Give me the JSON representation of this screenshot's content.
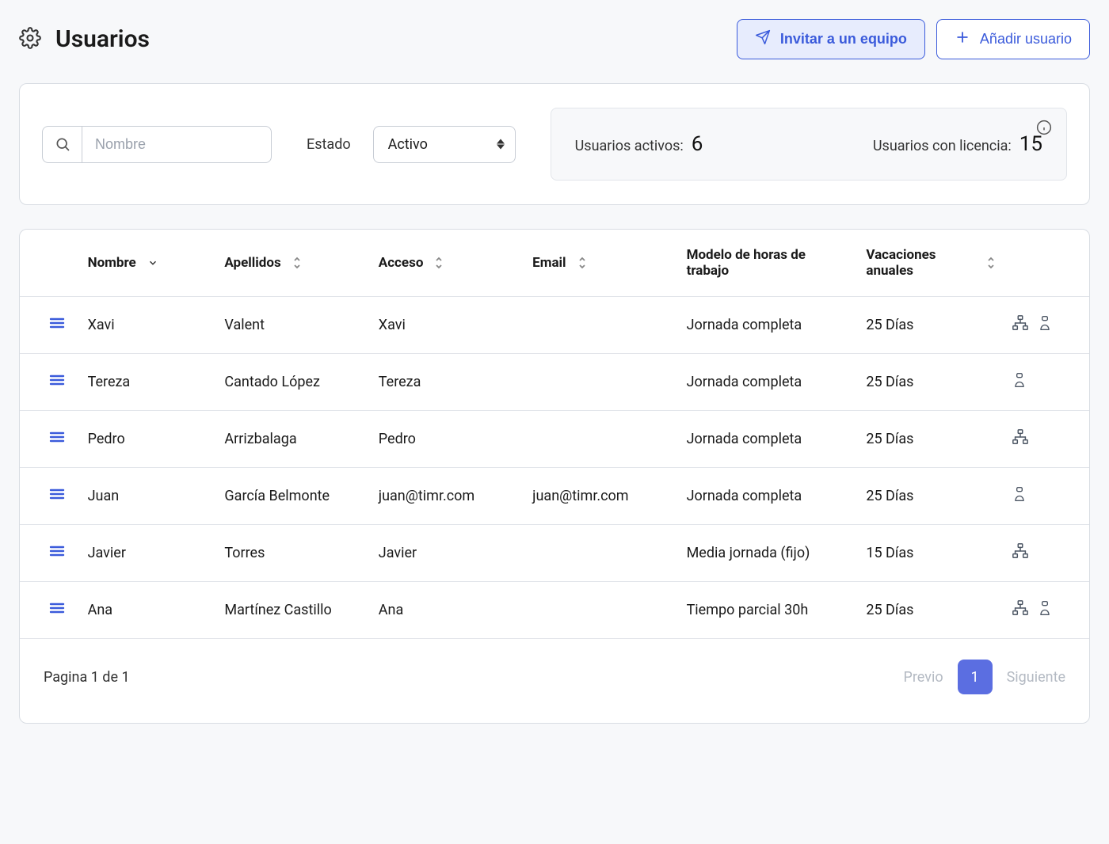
{
  "header": {
    "title": "Usuarios",
    "invite_label": "Invitar a un equipo",
    "add_user_label": "Añadir usuario"
  },
  "filter": {
    "search_placeholder": "Nombre",
    "state_label": "Estado",
    "state_value": "Activo"
  },
  "stats": {
    "active_label": "Usuarios activos:",
    "active_count": "6",
    "licensed_label": "Usuarios con licencia:",
    "licensed_count": "15"
  },
  "table": {
    "columns": {
      "name": "Nombre",
      "lastname": "Apellidos",
      "access": "Acceso",
      "email": "Email",
      "model": "Modelo de horas de trabajo",
      "vacation": "Vacaciones anuales"
    },
    "rows": [
      {
        "name": "Xavi",
        "lastname": "Valent",
        "access": "Xavi",
        "email": "",
        "model": "Jornada completa",
        "vacation": "25 Días",
        "icons": [
          "org",
          "user"
        ]
      },
      {
        "name": "Tereza",
        "lastname": "Cantado López",
        "access": "Tereza",
        "email": "",
        "model": "Jornada completa",
        "vacation": "25 Días",
        "icons": [
          "user"
        ]
      },
      {
        "name": "Pedro",
        "lastname": "Arrizbalaga",
        "access": "Pedro",
        "email": "",
        "model": "Jornada completa",
        "vacation": "25 Días",
        "icons": [
          "org"
        ]
      },
      {
        "name": "Juan",
        "lastname": "García Belmonte",
        "access": "juan@timr.com",
        "email": "juan@timr.com",
        "model": "Jornada completa",
        "vacation": "25 Días",
        "icons": [
          "user"
        ]
      },
      {
        "name": "Javier",
        "lastname": "Torres",
        "access": "Javier",
        "email": "",
        "model": "Media jornada (fijo)",
        "vacation": "15 Días",
        "icons": [
          "org"
        ]
      },
      {
        "name": "Ana",
        "lastname": "Martínez Castillo",
        "access": "Ana",
        "email": "",
        "model": "Tiempo parcial 30h",
        "vacation": "25 Días",
        "icons": [
          "org",
          "user"
        ]
      }
    ]
  },
  "footer": {
    "page_info": "Pagina 1 de 1",
    "prev": "Previo",
    "current": "1",
    "next": "Siguiente"
  }
}
